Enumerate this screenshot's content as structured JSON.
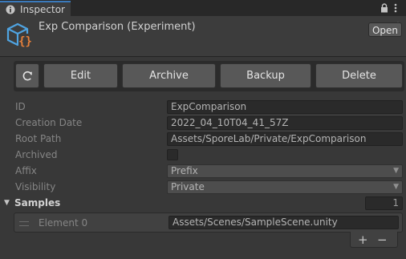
{
  "tab": {
    "title": "Inspector",
    "icon": "info-icon"
  },
  "tab_controls": {
    "lock": "lock-icon",
    "menu": "more-icon"
  },
  "header": {
    "title": "Exp Comparison (Experiment)",
    "icon": "experiment-asset-icon",
    "help_icon": "help-icon",
    "preset_icon": "presets-icon",
    "menu_icon": "more-icon",
    "open_label": "Open"
  },
  "toolbar": {
    "refresh_icon": "refresh-icon",
    "edit_label": "Edit",
    "archive_label": "Archive",
    "backup_label": "Backup",
    "delete_label": "Delete"
  },
  "fields": {
    "id_label": "ID",
    "id_value": "ExpComparison",
    "creation_label": "Creation Date",
    "creation_value": "2022_04_10T04_41_57Z",
    "root_label": "Root Path",
    "root_value": "Assets/SporeLab/Private/ExpComparison",
    "archived_label": "Archived",
    "archived_value": false,
    "affix_label": "Affix",
    "affix_value": "Prefix",
    "visibility_label": "Visibility",
    "visibility_value": "Private"
  },
  "samples": {
    "label": "Samples",
    "count": "1",
    "elements": [
      {
        "label": "Element 0",
        "value": "Assets/Scenes/SampleScene.unity"
      }
    ],
    "add_label": "+",
    "remove_label": "−"
  },
  "colors": {
    "accent": "#3a79bb",
    "asset_icon_blue": "#4fa3e0",
    "asset_icon_orange": "#e8803a"
  }
}
